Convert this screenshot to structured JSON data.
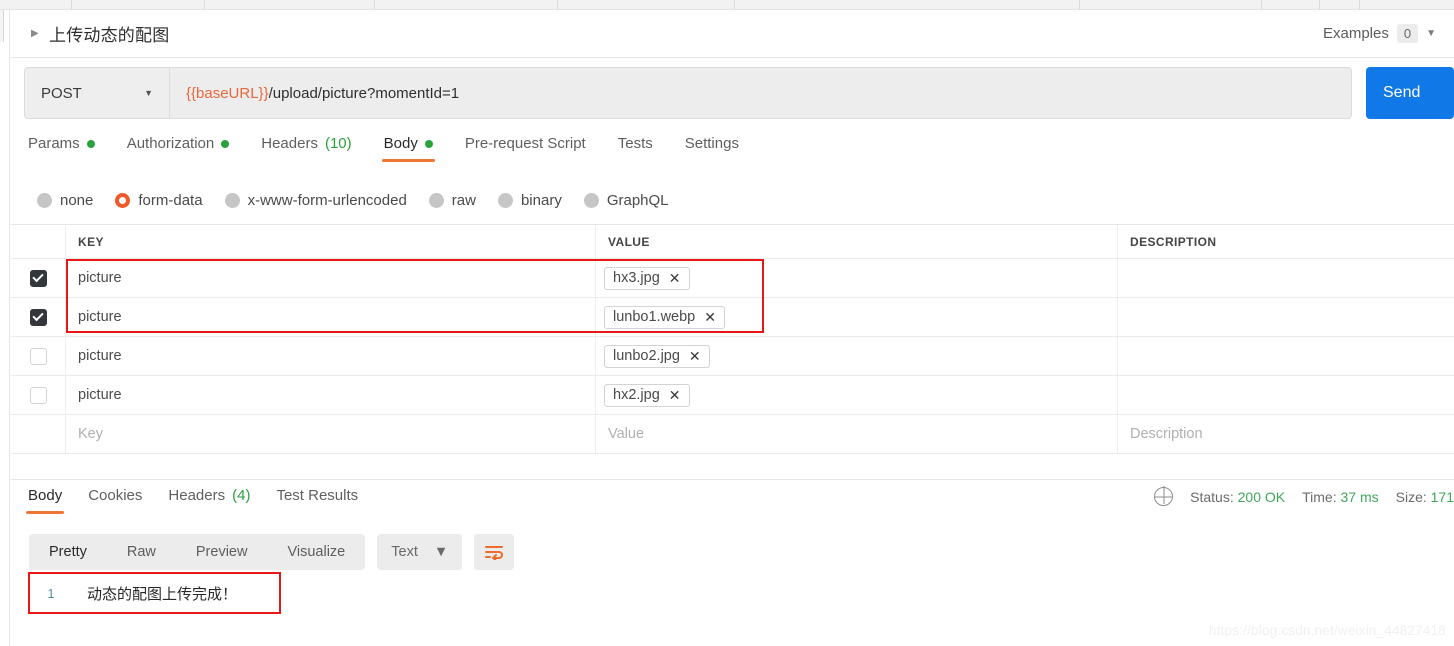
{
  "top_tabstrip": {
    "segment_count": 8
  },
  "request_header": {
    "collapse_icon": "caret-right-icon",
    "title": "上传动态的配图",
    "examples_label": "Examples",
    "examples_count": "0",
    "chevron_icon": "chevron-down-icon"
  },
  "url_bar": {
    "method": "POST",
    "method_chevron": "chevron-down-icon",
    "url_variable": "{{baseURL}}",
    "url_path": "/upload/picture?momentId=1",
    "send_label": "Send"
  },
  "request_tabs": [
    {
      "label": "Params",
      "dot": true,
      "count": "",
      "active": false
    },
    {
      "label": "Authorization",
      "dot": true,
      "count": "",
      "active": false
    },
    {
      "label": "Headers",
      "dot": false,
      "count": "(10)",
      "active": false
    },
    {
      "label": "Body",
      "dot": true,
      "count": "",
      "active": true
    },
    {
      "label": "Pre-request Script",
      "dot": false,
      "count": "",
      "active": false
    },
    {
      "label": "Tests",
      "dot": false,
      "count": "",
      "active": false
    },
    {
      "label": "Settings",
      "dot": false,
      "count": "",
      "active": false
    }
  ],
  "body_type_options": [
    {
      "label": "none",
      "selected": false
    },
    {
      "label": "form-data",
      "selected": true
    },
    {
      "label": "x-www-form-urlencoded",
      "selected": false
    },
    {
      "label": "raw",
      "selected": false
    },
    {
      "label": "binary",
      "selected": false
    },
    {
      "label": "GraphQL",
      "selected": false
    }
  ],
  "form_table": {
    "columns": {
      "key": "KEY",
      "value": "VALUE",
      "description": "DESCRIPTION"
    },
    "rows": [
      {
        "checked": true,
        "key": "picture",
        "value": "hx3.jpg",
        "is_file": true,
        "description": ""
      },
      {
        "checked": true,
        "key": "picture",
        "value": "lunbo1.webp",
        "is_file": true,
        "description": ""
      },
      {
        "checked": false,
        "key": "picture",
        "value": "lunbo2.jpg",
        "is_file": true,
        "description": ""
      },
      {
        "checked": false,
        "key": "picture",
        "value": "hx2.jpg",
        "is_file": true,
        "description": ""
      }
    ],
    "placeholder_row": {
      "key": "Key",
      "value": "Value",
      "description": "Description"
    },
    "remove_file_icon": "close-icon"
  },
  "response_tabs": [
    {
      "label": "Body",
      "count": "",
      "active": true
    },
    {
      "label": "Cookies",
      "count": "",
      "active": false
    },
    {
      "label": "Headers",
      "count": "(4)",
      "active": false
    },
    {
      "label": "Test Results",
      "count": "",
      "active": false
    }
  ],
  "response_stats": {
    "globe_icon": "globe-icon",
    "status_label": "Status:",
    "status_value": "200 OK",
    "time_label": "Time:",
    "time_value": "37 ms",
    "size_label": "Size:",
    "size_value": "171"
  },
  "format_bar": {
    "buttons": [
      {
        "label": "Pretty",
        "active": true
      },
      {
        "label": "Raw",
        "active": false
      },
      {
        "label": "Preview",
        "active": false
      },
      {
        "label": "Visualize",
        "active": false
      }
    ],
    "type_select": "Text",
    "type_chevron": "chevron-down-icon",
    "wrap_icon": "word-wrap-icon"
  },
  "response_body": {
    "lines": [
      {
        "number": "1",
        "text": "动态的配图上传完成！"
      }
    ]
  },
  "watermark": "https://blog.csdn.net/weixin_44827418",
  "annotations": {
    "rows_highlight": "red-box-form-rows",
    "response_highlight": "red-box-response-line"
  },
  "colors": {
    "accent_orange": "#ef7636",
    "send_blue": "#1178e8",
    "success_green": "#3fa75b",
    "annotation_red": "#e81818"
  }
}
